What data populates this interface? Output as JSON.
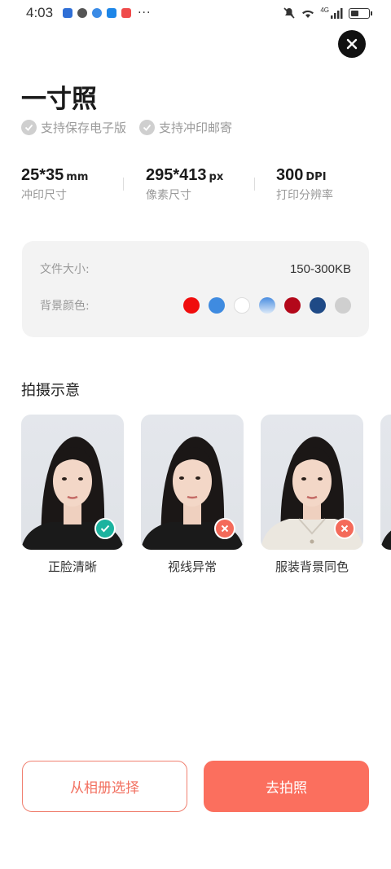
{
  "status_bar": {
    "time": "4:03",
    "more": "···",
    "network": "4G"
  },
  "header": {
    "title": "一寸照"
  },
  "features": [
    "支持保存电子版",
    "支持冲印邮寄"
  ],
  "specs": [
    {
      "value": "25*35",
      "unit": "mm",
      "label": "冲印尺寸"
    },
    {
      "value": "295*413",
      "unit": "px",
      "label": "像素尺寸"
    },
    {
      "value": "300",
      "unit": "DPI",
      "label": "打印分辨率"
    }
  ],
  "info": {
    "file_size_label": "文件大小:",
    "file_size_value": "150-300KB",
    "bg_color_label": "背景颜色:",
    "colors": [
      "#f00d0d",
      "#3f8be0",
      "#ffffff",
      "gradient-blue",
      "#b3081a",
      "#1f4a86",
      "#cfcfcf"
    ]
  },
  "examples": {
    "title": "拍摄示意",
    "items": [
      {
        "label": "正脸清晰",
        "status": "ok"
      },
      {
        "label": "视线异常",
        "status": "error"
      },
      {
        "label": "服装背景同色",
        "status": "error"
      }
    ]
  },
  "buttons": {
    "album": "从相册选择",
    "shoot": "去拍照"
  },
  "colors": {
    "accent": "#fb6f5e",
    "ok_badge": "#1cb39f",
    "error_badge": "#f46a5a"
  }
}
